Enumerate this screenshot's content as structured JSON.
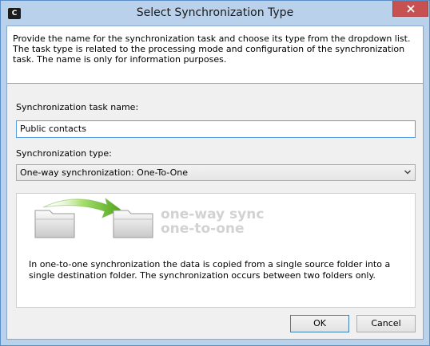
{
  "window": {
    "title": "Select Synchronization Type",
    "app_icon": "C",
    "close_icon": "close-icon"
  },
  "header": {
    "description": "Provide the name for the synchronization task and choose its type from the dropdown list. The task type is related to the processing mode and configuration of the synchronization task. The name is only for information purposes."
  },
  "form": {
    "name_label": "Synchronization task name:",
    "name_value": "Public contacts",
    "type_label": "Synchronization type:",
    "type_value": "One-way synchronization: One-To-One"
  },
  "info": {
    "heading_line1": "one-way sync",
    "heading_line2": "one-to-one",
    "description": "In one-to-one synchronization the data is copied from a single source folder into a single destination folder. The synchronization occurs between two folders only."
  },
  "buttons": {
    "ok": "OK",
    "cancel": "Cancel"
  },
  "colors": {
    "titlebar": "#b9d1ea",
    "close_button": "#c75050",
    "arrow": "#6fbf2a",
    "heading_gray": "#d2d2d2"
  }
}
